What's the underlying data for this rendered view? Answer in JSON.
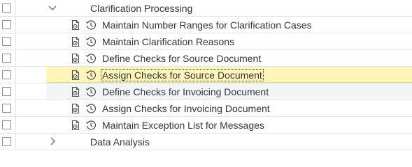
{
  "tree": {
    "group": {
      "label": "Clarification Processing",
      "toggle_icon": "chevron-down-icon"
    },
    "activities": [
      {
        "label": "Maintain Number Ranges for Clarification Cases"
      },
      {
        "label": "Maintain Clarification Reasons"
      },
      {
        "label": "Define Checks for Source Document"
      },
      {
        "label": "Assign Checks for Source Document"
      },
      {
        "label": "Define Checks for Invoicing Document"
      },
      {
        "label": "Assign Checks for Invoicing Document"
      },
      {
        "label": "Maintain Exception List for Messages"
      }
    ],
    "next_group": {
      "label": "Data Analysis",
      "toggle_icon": "chevron-right-icon"
    },
    "activity_icons": [
      "customizing-document-icon",
      "history-clock-icon"
    ],
    "selected_row_color": "#fef7b9"
  }
}
